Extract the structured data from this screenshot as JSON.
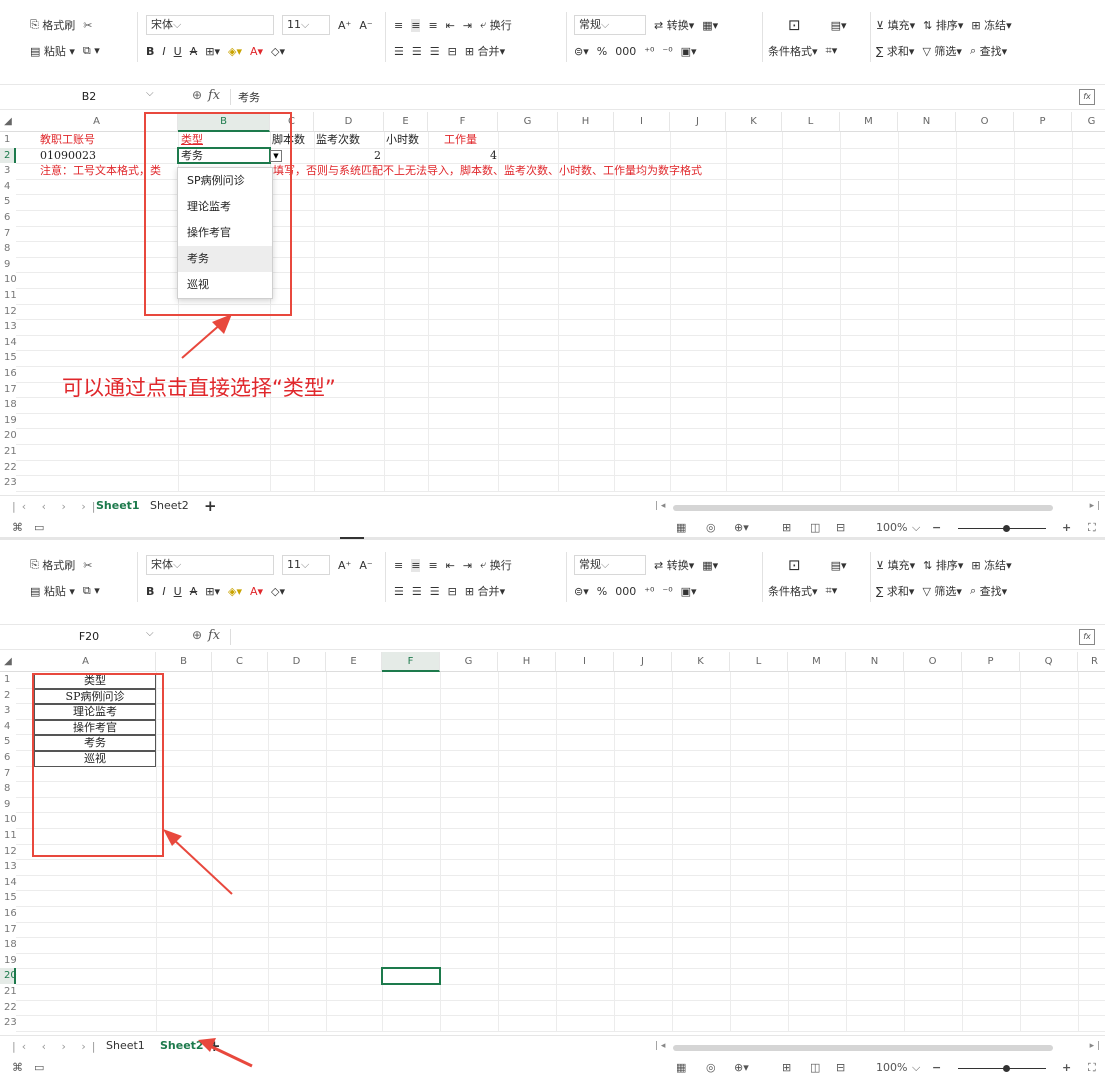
{
  "ribbon": {
    "format_painter": "格式刷",
    "paste": "粘贴",
    "font_name": "宋体",
    "font_size": "11",
    "bold": "B",
    "italic": "I",
    "underline": "U",
    "strike": "A",
    "wrap": "换行",
    "merge": "合并",
    "number_format": "常规",
    "convert": "转换",
    "conditional_format": "条件格式",
    "fill": "填充",
    "sort": "排序",
    "freeze": "冻结",
    "sum": "求和",
    "filter": "筛选",
    "find": "查找",
    "percent": "%",
    "thousands": "000"
  },
  "panel1": {
    "namebox": "B2",
    "formula_value": "考务",
    "columns": [
      "A",
      "B",
      "C",
      "D",
      "E",
      "F",
      "G",
      "H",
      "I",
      "J",
      "K",
      "L",
      "M",
      "N",
      "O",
      "P",
      "G"
    ],
    "rows": [
      "1",
      "2",
      "3",
      "4",
      "5",
      "6",
      "7",
      "8",
      "9",
      "10",
      "11",
      "12",
      "13",
      "14",
      "15",
      "16",
      "17",
      "18",
      "19",
      "20",
      "21",
      "22",
      "23"
    ],
    "row1": {
      "a": "教职工账号",
      "b": "类型",
      "c": "脚本数",
      "d": "监考次数",
      "e": "小时数",
      "f": "工作量"
    },
    "row2": {
      "a": "01090023",
      "b": "考务",
      "c": "2",
      "e": "4"
    },
    "row3_note_left": "注意：工号文本格式，类",
    "row3_note_right": "填写，否则与系统匹配不上无法导入，脚本数、监考次数、小时数、工作量均为数字格式",
    "dropdown_options": [
      "SP病例问诊",
      "理论监考",
      "操作考官",
      "考务",
      "巡视"
    ],
    "annotation": "可以通过点击直接选择“类型”",
    "tabs": [
      "Sheet1",
      "Sheet2"
    ],
    "active_tab": "Sheet1",
    "zoom": "100%"
  },
  "panel2": {
    "namebox": "F20",
    "formula_value": "",
    "columns": [
      "A",
      "B",
      "C",
      "D",
      "E",
      "F",
      "G",
      "H",
      "I",
      "J",
      "K",
      "L",
      "M",
      "N",
      "O",
      "P",
      "Q",
      "R"
    ],
    "rows": [
      "1",
      "2",
      "3",
      "4",
      "5",
      "6",
      "7",
      "8",
      "9",
      "10",
      "11",
      "12",
      "13",
      "14",
      "15",
      "16",
      "17",
      "18",
      "19",
      "20",
      "21",
      "22",
      "23"
    ],
    "list": [
      "类型",
      "SP病例问诊",
      "理论监考",
      "操作考官",
      "考务",
      "巡视"
    ],
    "tabs": [
      "Sheet1",
      "Sheet2"
    ],
    "active_tab": "Sheet2",
    "zoom": "100%"
  },
  "colors": {
    "accent": "#1d7a4c",
    "annotation_red": "#e0272b",
    "box_red": "#e8483d"
  }
}
